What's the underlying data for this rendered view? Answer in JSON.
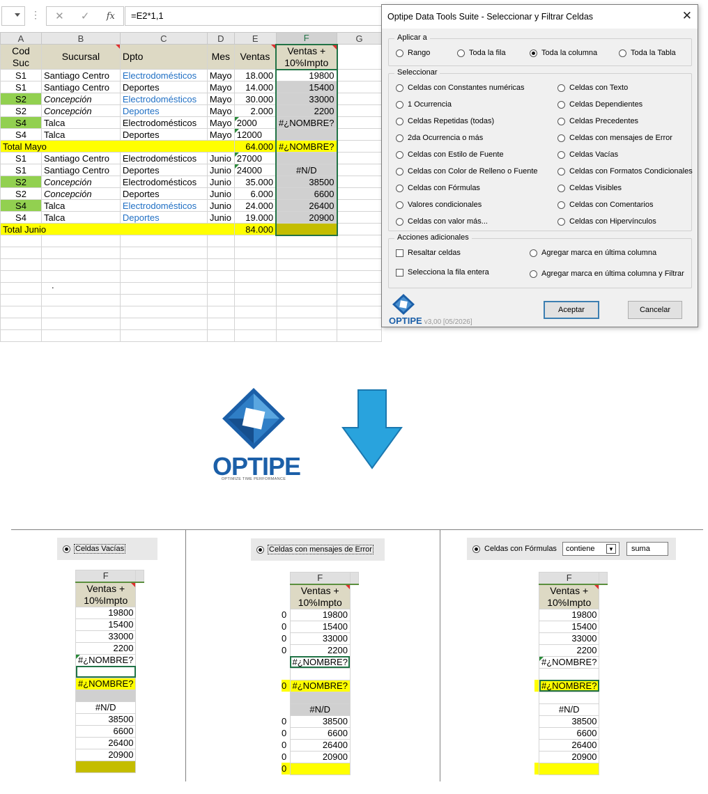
{
  "formula_bar": {
    "formula": "=E2*1,1",
    "fx": "fx",
    "cancel_icon": "✕",
    "enter_icon": "✓"
  },
  "sheet": {
    "columns": [
      "A",
      "B",
      "C",
      "D",
      "E",
      "F",
      "G"
    ],
    "headers": [
      "Cod Suc",
      "Sucursal",
      "Dpto",
      "Mes",
      "Ventas",
      "Ventas + 10%Impto"
    ],
    "stray_mark": "."
  },
  "rows": [
    {
      "cod": "S1",
      "suc": "Santiago Centro",
      "dpto": "Electrodomésticos",
      "mes": "Mayo",
      "ventas": "18.000",
      "f": "19800"
    },
    {
      "cod": "S1",
      "suc": "Santiago Centro",
      "dpto": "Deportes",
      "mes": "Mayo",
      "ventas": "14.000",
      "f": "15400"
    },
    {
      "cod": "S2",
      "suc": "Concepción",
      "dpto": "Electrodomésticos",
      "mes": "Mayo",
      "ventas": "30.000",
      "f": "33000"
    },
    {
      "cod": "S2",
      "suc": "Concepción",
      "dpto": "Deportes",
      "mes": "Mayo",
      "ventas": "2.000",
      "f": "2200"
    },
    {
      "cod": "S4",
      "suc": "Talca",
      "dpto": "Electrodomésticos",
      "mes": "Mayo",
      "ventas": "2000",
      "f": "#¿NOMBRE?"
    },
    {
      "cod": "S4",
      "suc": "Talca",
      "dpto": "Deportes",
      "mes": "Mayo",
      "ventas": "12000",
      "f": ""
    },
    {
      "total": "Total Mayo",
      "ventas": "64.000",
      "f": "#¿NOMBRE?"
    },
    {
      "cod": "S1",
      "suc": "Santiago Centro",
      "dpto": "Electrodomésticos",
      "mes": "Junio",
      "ventas": "27000",
      "f": ""
    },
    {
      "cod": "S1",
      "suc": "Santiago Centro",
      "dpto": "Deportes",
      "mes": "Junio",
      "ventas": "24000",
      "f": "#N/D"
    },
    {
      "cod": "S2",
      "suc": "Concepción",
      "dpto": "Electrodomésticos",
      "mes": "Junio",
      "ventas": "35.000",
      "f": "38500"
    },
    {
      "cod": "S2",
      "suc": "Concepción",
      "dpto": "Deportes",
      "mes": "Junio",
      "ventas": "6.000",
      "f": "6600"
    },
    {
      "cod": "S4",
      "suc": "Talca",
      "dpto": "Electrodomésticos",
      "mes": "Junio",
      "ventas": "24.000",
      "f": "26400"
    },
    {
      "cod": "S4",
      "suc": "Talca",
      "dpto": "Deportes",
      "mes": "Junio",
      "ventas": "19.000",
      "f": "20900"
    },
    {
      "total": "Total Junio",
      "ventas": "84.000",
      "f": ""
    }
  ],
  "dialog": {
    "title": "Optipe Data Tools Suite - Seleccionar y Filtrar Celdas",
    "close": "✕",
    "apply_group": "Aplicar a",
    "apply_options": [
      "Rango",
      "Toda la fila",
      "Toda la columna",
      "Toda la Tabla"
    ],
    "apply_selected": "Toda la columna",
    "select_group": "Seleccionar",
    "select_left": [
      "Celdas con Constantes numéricas",
      "1 Ocurrencia",
      "Celdas Repetidas (todas)",
      "2da Ocurrencia o más",
      "Celdas con Estilo de Fuente",
      "Celdas con Color de Relleno o Fuente",
      "Celdas con Fórmulas",
      "Valores condicionales",
      "Celdas con valor más..."
    ],
    "select_right": [
      "Celdas con Texto",
      "Celdas Dependientes",
      "Celdas Precedentes",
      "Celdas con mensajes de Error",
      "Celdas Vacías",
      "Celdas con Formatos Condicionales",
      "Celdas Visibles",
      "Celdas con Comentarios",
      "Celdas con Hipervínculos"
    ],
    "actions_group": "Acciones adicionales",
    "actions_check": [
      "Resaltar celdas",
      "Selecciona la fila entera"
    ],
    "actions_radio": [
      "Agregar marca en última columna",
      "Agregar marca en última columna y Filtrar"
    ],
    "accept": "Aceptar",
    "cancel": "Cancelar",
    "brand": "OPTIPE",
    "version": "v3,00 [05/2026]"
  },
  "logo": {
    "word": "OPTIPE",
    "tagline": "OPTIMIZE TIME PERFORMANCE"
  },
  "colors": {
    "arrow": "#29a3dd",
    "brand": "#1b5fa8",
    "header_fill": "#ddd9c4",
    "green_fill": "#92d050",
    "total_fill": "#ffff00"
  },
  "examples": [
    {
      "option": "Celdas Vacías",
      "col": "F",
      "header": "Ventas + 10%Impto",
      "values": [
        "19800",
        "15400",
        "33000",
        "2200",
        "#¿NOMBRE?",
        "",
        "#¿NOMBRE?",
        "",
        "#N/D",
        "38500",
        "6600",
        "26400",
        "20900",
        ""
      ]
    },
    {
      "option": "Celdas con mensajes de Error",
      "col": "F",
      "header": "Ventas + 10%Impto",
      "left_values": [
        "0",
        "0",
        "0",
        "0",
        "",
        "",
        "0",
        "",
        "",
        "0",
        "0",
        "0",
        "0",
        "0"
      ],
      "values": [
        "19800",
        "15400",
        "33000",
        "2200",
        "#¿NOMBRE?",
        "",
        "#¿NOMBRE?",
        "",
        "#N/D",
        "38500",
        "6600",
        "26400",
        "20900",
        ""
      ]
    },
    {
      "option": "Celdas con Fórmulas",
      "condition": "contiene",
      "condition_value": "suma",
      "col": "F",
      "header": "Ventas + 10%Impto",
      "values": [
        "19800",
        "15400",
        "33000",
        "2200",
        "#¿NOMBRE?",
        "",
        "#¿NOMBRE?",
        "",
        "#N/D",
        "38500",
        "6600",
        "26400",
        "20900",
        ""
      ]
    }
  ]
}
